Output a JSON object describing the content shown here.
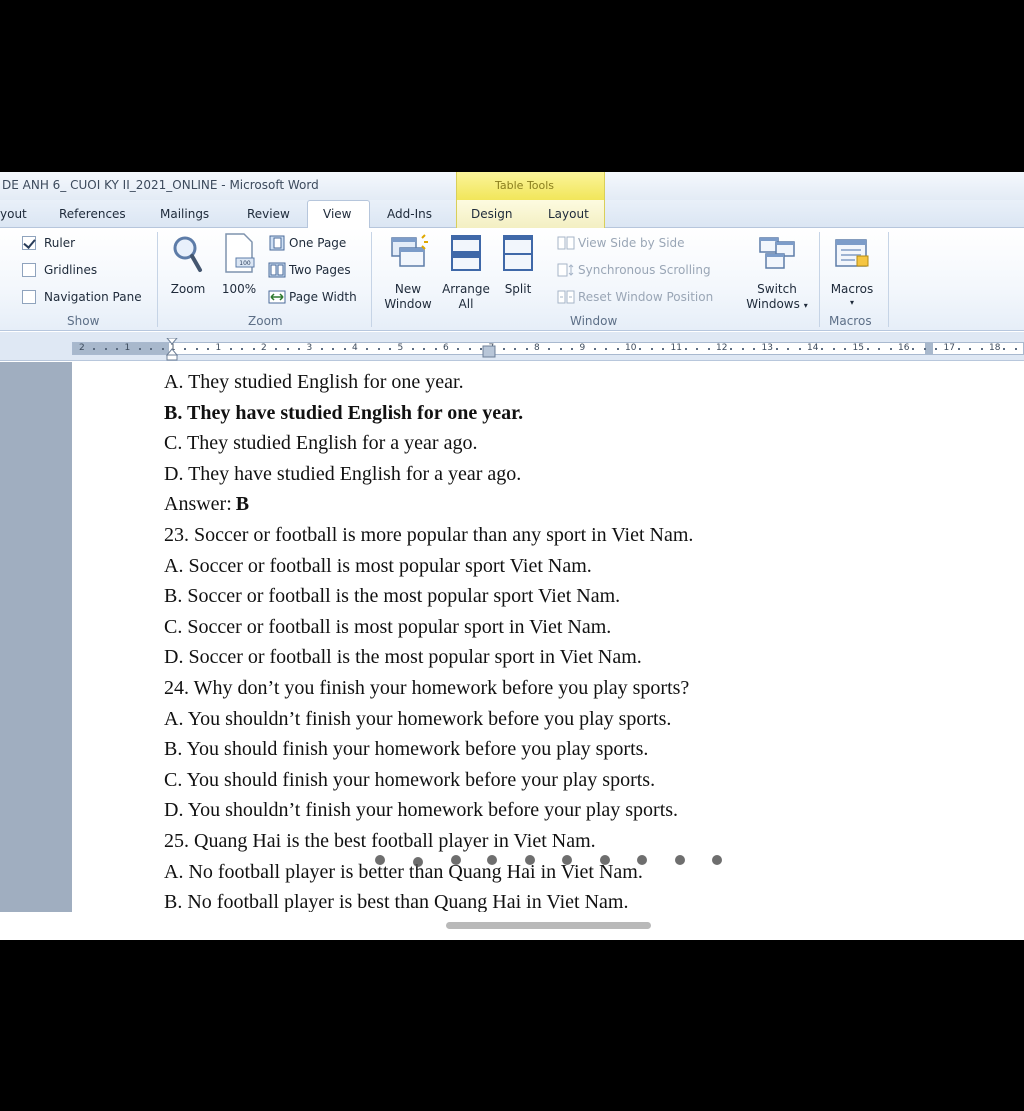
{
  "window": {
    "title": "DE ANH 6_ CUOI KY II_2021_ONLINE  -  Microsoft Word",
    "table_tools": "Table Tools"
  },
  "tabs": [
    {
      "label": "yout"
    },
    {
      "label": "References"
    },
    {
      "label": "Mailings"
    },
    {
      "label": "Review"
    },
    {
      "label": "View",
      "active": true
    },
    {
      "label": "Add-Ins"
    },
    {
      "label": "Design"
    },
    {
      "label": "Layout"
    }
  ],
  "ribbon": {
    "show": {
      "label": "Show",
      "ruler": {
        "label": "Ruler",
        "checked": true
      },
      "gridlines": {
        "label": "Gridlines",
        "checked": false
      },
      "navpane": {
        "label": "Navigation Pane",
        "checked": false
      }
    },
    "zoom": {
      "label": "Zoom",
      "zoom_btn": "Zoom",
      "hundred_btn": "100%",
      "one_page": "One Page",
      "two_pages": "Two Pages",
      "page_width": "Page Width"
    },
    "window": {
      "label": "Window",
      "new_window_1": "New",
      "new_window_2": "Window",
      "arrange_1": "Arrange",
      "arrange_2": "All",
      "split": "Split",
      "side_by_side": "View Side by Side",
      "sync_scroll": "Synchronous Scrolling",
      "reset_pos": "Reset Window Position",
      "switch_1": "Switch",
      "switch_2": "Windows"
    },
    "macros": {
      "label": "Macros",
      "btn": "Macros"
    }
  },
  "ruler_numbers": [
    "2",
    "1",
    "1",
    "1",
    "2",
    "3",
    "4",
    "5",
    "6",
    "7",
    "8",
    "9",
    "10",
    "11",
    "12",
    "13",
    "14",
    "15",
    "16",
    "17",
    "18"
  ],
  "document": {
    "lines": [
      {
        "text": "A. They studied English for one year.",
        "bold": false
      },
      {
        "text": "B. They have studied English for one year.",
        "bold": true
      },
      {
        "text": "C. They studied English for a year ago.",
        "bold": false
      },
      {
        "text": "D. They have studied English for a year ago.",
        "bold": false
      },
      {
        "text": "23. Soccer or football is more popular than any sport in Viet Nam.",
        "bold": false
      },
      {
        "text": "A. Soccer or football is most popular sport Viet Nam.",
        "bold": false
      },
      {
        "text": "B. Soccer or football is the most popular sport Viet Nam.",
        "bold": false
      },
      {
        "text": "C. Soccer or football is most popular sport in Viet Nam.",
        "bold": false
      },
      {
        "text": "D. Soccer or football is the most popular sport in Viet Nam.",
        "bold": false
      },
      {
        "text": "24. Why don’t you finish your homework before you play sports?",
        "bold": false
      },
      {
        "text": "A. You shouldn’t finish your homework before you play sports.",
        "bold": false
      },
      {
        "text": "B. You should finish your homework before you play sports.",
        "bold": false
      },
      {
        "text": "C. You should finish your homework before your play sports.",
        "bold": false
      },
      {
        "text": "D. You shouldn’t finish your homework before your play sports.",
        "bold": false
      },
      {
        "text": "25. Quang Hai is the best football player in Viet Nam.",
        "bold": false
      },
      {
        "text": "A. No football player is better than Quang Hai in Viet Nam.",
        "bold": false
      },
      {
        "text": "B. No football player is best than Quang Hai in Viet Nam.",
        "bold": false
      }
    ],
    "answer": {
      "label": "Answer:",
      "value": "B"
    }
  }
}
